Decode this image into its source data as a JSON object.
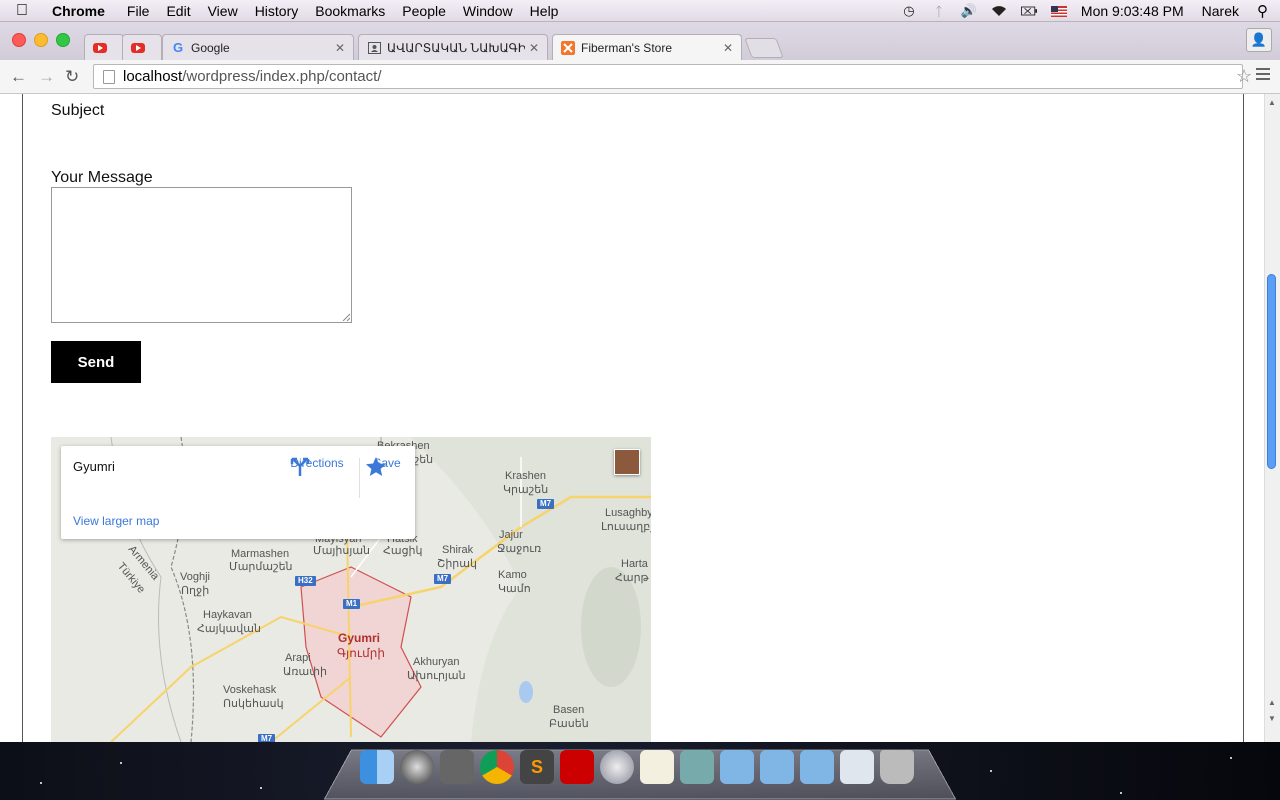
{
  "menubar": {
    "app_name": "Chrome",
    "items": [
      "File",
      "Edit",
      "View",
      "History",
      "Bookmarks",
      "People",
      "Window",
      "Help"
    ],
    "clock": "Mon 9:03:48 PM",
    "user": "Narek"
  },
  "tabs": [
    {
      "title": "",
      "icon": "youtube-icon"
    },
    {
      "title": "",
      "icon": "youtube-icon"
    },
    {
      "title": "Google",
      "icon": "google-icon"
    },
    {
      "title": "ԱՎԱՐՏԱԿԱՆ ՆԱԽԱԳԻԾ",
      "icon": "contact-card-icon"
    },
    {
      "title": "Fiberman's Store",
      "icon": "xampp-icon",
      "active": true
    }
  ],
  "address_bar": {
    "host": "localhost",
    "path": "/wordpress/index.php/contact/"
  },
  "form": {
    "subject_label": "Subject",
    "message_label": "Your Message",
    "message_value": "",
    "send_label": "Send"
  },
  "map": {
    "place_name": "Gyumri",
    "directions_label": "Directions",
    "save_label": "Save",
    "larger_map_label": "View larger map",
    "labels": [
      {
        "text": "Bekrashen",
        "sub": "Բեկաշեն"
      },
      {
        "text": "Krashen",
        "sub": "Կրաշեն"
      },
      {
        "text": "Lusaghbyur",
        "sub": "Լուսաղբյուր"
      },
      {
        "text": "Jajur",
        "sub": "Ջաջուռ"
      },
      {
        "text": "Shirak",
        "sub": "Շիրակ"
      },
      {
        "text": "Mayisyan",
        "sub": "Մայիսյան"
      },
      {
        "text": "Hatsik",
        "sub": "Հացիկ"
      },
      {
        "text": "Marmashen",
        "sub": "Մարմաշեն"
      },
      {
        "text": "Voghji",
        "sub": "Ողջի"
      },
      {
        "text": "Kamo",
        "sub": "Կամո"
      },
      {
        "text": "Harta",
        "sub": "Հարթ"
      },
      {
        "text": "Haykavan",
        "sub": "Հայկավան"
      },
      {
        "text": "Arapi",
        "sub": "Առափի"
      },
      {
        "text": "Akhuryan",
        "sub": "Ախուրյան"
      },
      {
        "text": "Voskehask",
        "sub": "Ոսկեհասկ"
      },
      {
        "text": "Basen",
        "sub": "Բասեն"
      }
    ],
    "city": {
      "text": "Gyumri",
      "sub": "Գյումրի"
    },
    "border_labels": [
      "Armenia",
      "Türkiye"
    ],
    "shields": [
      "M7",
      "M7",
      "H32",
      "M1",
      "M7"
    ]
  },
  "colors": {
    "link_blue": "#3b78d8",
    "send_bg": "#000000",
    "city_red": "#b03030"
  }
}
